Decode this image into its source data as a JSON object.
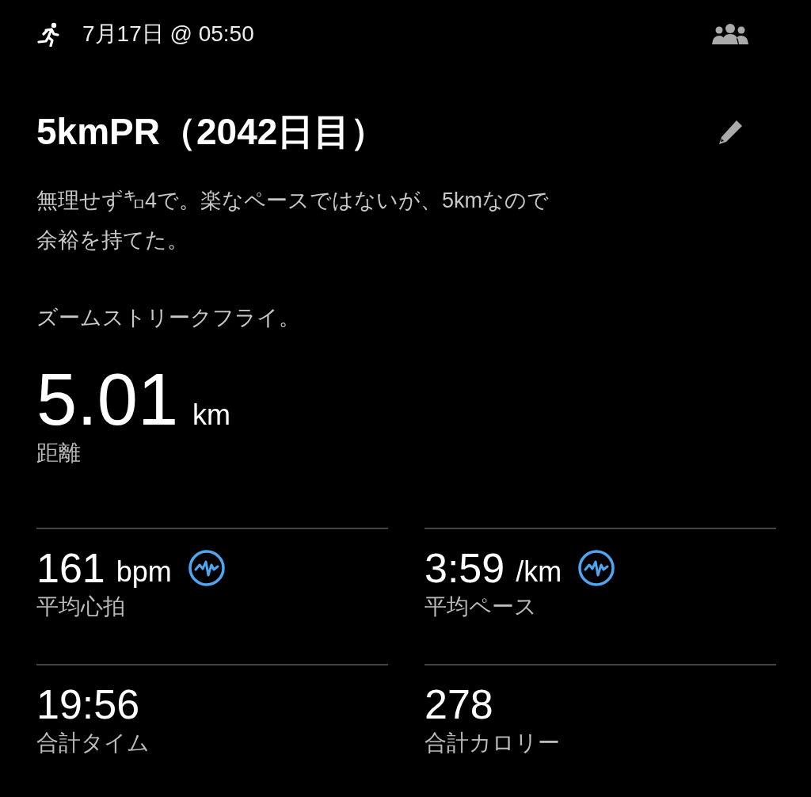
{
  "header": {
    "datetime": "7月17日 @ 05:50"
  },
  "title": "5kmPR（2042日目）",
  "description": [
    [
      "無理せず㌔4で。楽なペースではないが、5kmなので",
      "余裕を持てた。"
    ],
    [
      "ズームストリークフライ。"
    ]
  ],
  "distance": {
    "value": "5.01",
    "unit": "km",
    "label": "距離"
  },
  "stats": [
    {
      "value": "161",
      "unit": "bpm",
      "label": "平均心拍",
      "chart_icon": true
    },
    {
      "value": "3:59",
      "unit": "/km",
      "label": "平均ペース",
      "chart_icon": true
    },
    {
      "value": "19:56",
      "label": "合計タイム",
      "chart_icon": false
    },
    {
      "value": "278",
      "label": "合計カロリー",
      "chart_icon": false
    }
  ]
}
